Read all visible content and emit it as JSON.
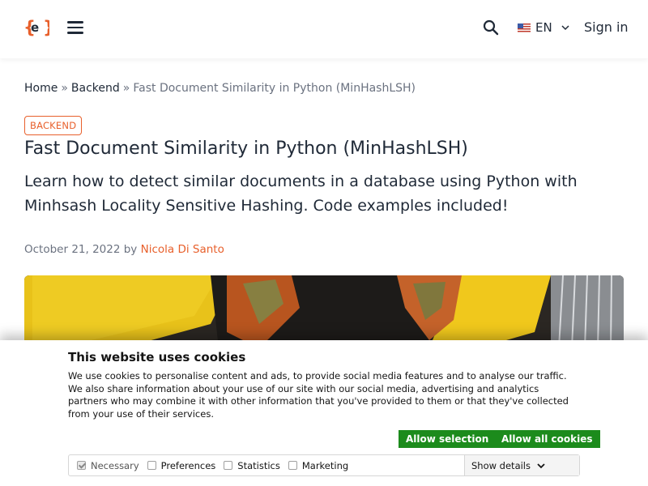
{
  "header": {
    "logo_text": "{e}",
    "language": "EN",
    "sign_in": "Sign in"
  },
  "breadcrumb": {
    "home": "Home",
    "sep1": "»",
    "section": "Backend",
    "sep2": "»",
    "current": "Fast Document Similarity in Python (MinHashLSH)"
  },
  "article": {
    "category": "BACKEND",
    "title": "Fast Document Similarity in Python (MinHashLSH)",
    "subtitle": "Learn how to detect similar documents in a database using Python with Minhsash Locality Sensitive Hashing. Code examples included!",
    "date": "October 21, 2022",
    "by": "by",
    "author": "Nicola Di Santo"
  },
  "cookie_banner": {
    "title": "This website uses cookies",
    "text": "We use cookies to personalise content and ads, to provide social media features and to analyse our traffic. We also share information about your use of our site with our social media, advertising and analytics partners who may combine it with other information that you've provided to them or that they've collected from your use of their services.",
    "allow_selection": "Allow selection",
    "allow_all": "Allow all cookies",
    "options": {
      "necessary": "Necessary",
      "preferences": "Preferences",
      "statistics": "Statistics",
      "marketing": "Marketing"
    },
    "show_details": "Show details"
  },
  "colors": {
    "accent": "#e8602c",
    "button_green": "#1c8b1c",
    "text": "#1f2937",
    "muted": "#6b7280"
  },
  "icons": {
    "logo": "brand-logo-icon",
    "menu": "hamburger-icon",
    "search": "search-icon",
    "flag": "us-flag-icon",
    "chevron": "chevron-down-icon"
  }
}
